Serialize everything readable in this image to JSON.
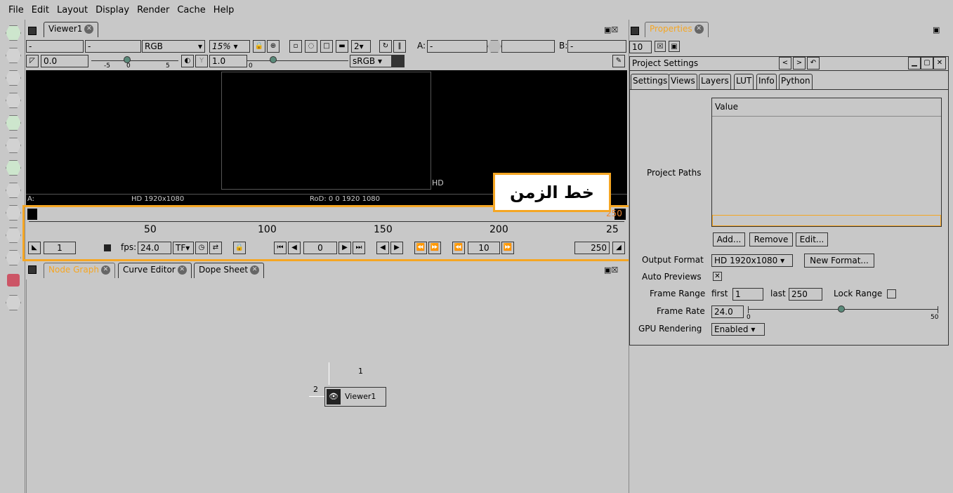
{
  "menu": [
    "File",
    "Edit",
    "Layout",
    "Display",
    "Render",
    "Cache",
    "Help"
  ],
  "viewer": {
    "tab": "Viewer1",
    "input_a": "-",
    "input_b": "-",
    "channels": "RGB",
    "zoom": "15%",
    "proxy": "2",
    "a_label": "A:",
    "a_value": "-",
    "b_label": "B:",
    "b_value": "-",
    "gain": "0.0",
    "gamma": "1.0",
    "colorspace": "sRGB",
    "gain_ticks": [
      "-5",
      "0",
      "5"
    ],
    "gamma_ticks": [
      "0"
    ],
    "format_tag": "HD",
    "info_a": "A:",
    "info_format": "HD 1920x1080",
    "info_rod": "RoD: 0 0 1920 1080"
  },
  "annotation": {
    "text": "خط الزمن",
    "color": "#f5a623"
  },
  "timeline": {
    "ticks": [
      "50",
      "100",
      "150",
      "200",
      "25"
    ],
    "marker_right": "250",
    "first_frame": "1",
    "fps_label": "fps:",
    "fps": "24.0",
    "tf": "TF",
    "current_frame": "0",
    "increment": "10",
    "last_frame": "250"
  },
  "nodegraph": {
    "tabs": [
      "Node Graph",
      "Curve Editor",
      "Dope Sheet"
    ],
    "node_label": "Viewer1",
    "input1": "1",
    "input2": "2"
  },
  "properties": {
    "tab": "Properties",
    "max_panels": "10",
    "title": "Project Settings",
    "subtabs": [
      "Settings",
      "Views",
      "Layers",
      "LUT",
      "Info",
      "Python"
    ],
    "table_header": "Value",
    "paths_label": "Project Paths",
    "add": "Add...",
    "remove": "Remove",
    "edit": "Edit...",
    "output_format_label": "Output Format",
    "output_format": "HD 1920x1080",
    "new_format": "New Format...",
    "auto_previews_label": "Auto Previews",
    "frame_range_label": "Frame Range",
    "first_label": "first",
    "first": "1",
    "last_label": "last",
    "last": "250",
    "lock_range_label": "Lock Range",
    "frame_rate_label": "Frame Rate",
    "frame_rate": "24.0",
    "rate_ticks": [
      "0",
      "50"
    ],
    "gpu_label": "GPU Rendering",
    "gpu": "Enabled"
  }
}
